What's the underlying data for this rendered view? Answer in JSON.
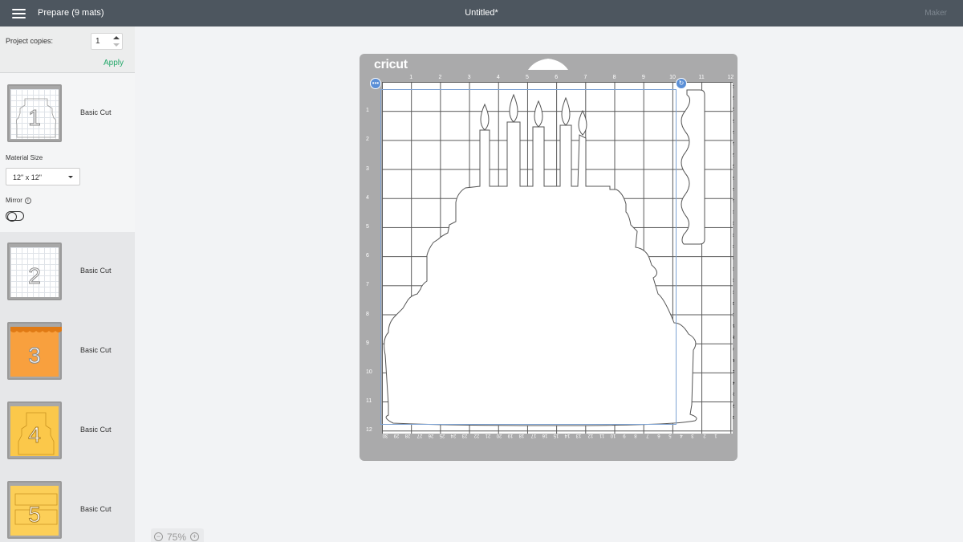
{
  "header": {
    "prepare_title": "Prepare (9 mats)",
    "document_title": "Untitled*",
    "machine": "Maker"
  },
  "sidebar": {
    "copies_label": "Project copies:",
    "copies_value": "1",
    "apply_label": "Apply",
    "material_size_label": "Material Size",
    "material_size_value": "12\" x 12\"",
    "mirror_label": "Mirror",
    "mirror_on": false,
    "mats": [
      {
        "number": "1",
        "label": "Basic Cut",
        "color": "#ffffff"
      },
      {
        "number": "2",
        "label": "Basic Cut",
        "color": "#ffffff"
      },
      {
        "number": "3",
        "label": "Basic Cut",
        "color": "#f8a03e"
      },
      {
        "number": "4",
        "label": "Basic Cut",
        "color": "#fbc84a"
      },
      {
        "number": "5",
        "label": "Basic Cut",
        "color": "#fccf58"
      }
    ]
  },
  "mat": {
    "logo": "cricut",
    "ruler_top": [
      "1",
      "2",
      "3",
      "4",
      "5",
      "6",
      "7",
      "8",
      "9",
      "10",
      "11",
      "12"
    ],
    "ruler_left": [
      "1",
      "2",
      "3",
      "4",
      "5",
      "6",
      "7",
      "8",
      "9",
      "10",
      "11",
      "12"
    ],
    "ruler_right": [
      "30",
      "29",
      "28",
      "27",
      "26",
      "25",
      "24",
      "23",
      "22",
      "21",
      "20",
      "19",
      "18",
      "17",
      "16",
      "15",
      "14",
      "13",
      "12",
      "11",
      "10",
      "9",
      "8",
      "7",
      "6",
      "5",
      "4",
      "3",
      "2",
      "1"
    ],
    "ruler_bottom": [
      "30",
      "29",
      "28",
      "27",
      "26",
      "25",
      "24",
      "23",
      "22",
      "21",
      "20",
      "19",
      "18",
      "17",
      "16",
      "15",
      "14",
      "13",
      "12",
      "11",
      "10",
      "9",
      "8",
      "7",
      "6",
      "5",
      "4",
      "3",
      "2",
      "1"
    ]
  },
  "zoom": {
    "value": "75%"
  }
}
